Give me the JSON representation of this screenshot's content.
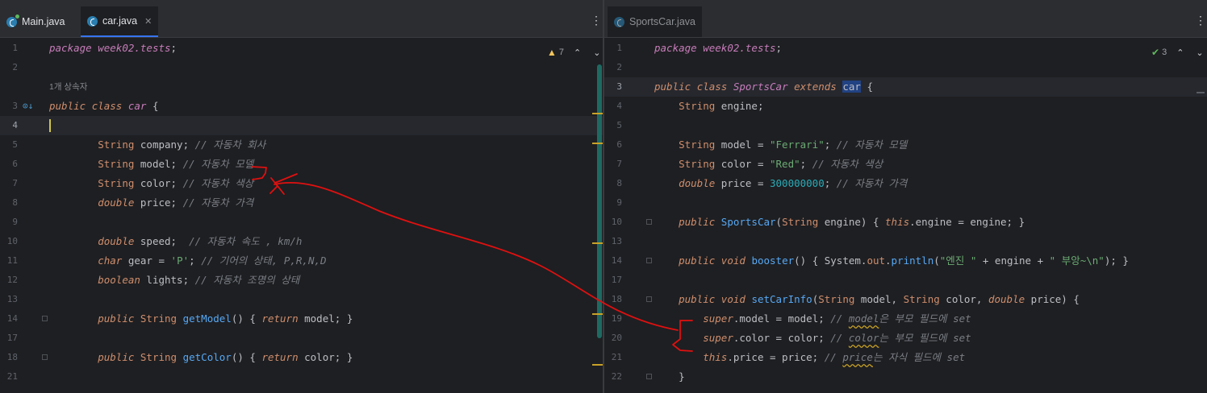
{
  "left": {
    "tabs": [
      {
        "label": "Main.java",
        "active": false
      },
      {
        "label": "car.java",
        "active": true
      }
    ],
    "inspection": {
      "count": "7"
    },
    "inheritors_hint": "1개 상속자",
    "lines": [
      {
        "n": "1",
        "tokens": [
          [
            "pkg",
            "package"
          ],
          [
            "t",
            " "
          ],
          [
            "pkg",
            "week02.tests"
          ],
          [
            "t",
            ";"
          ]
        ]
      },
      {
        "n": "2",
        "tokens": []
      },
      {
        "n": "3",
        "tokens": [
          [
            "kw",
            "public"
          ],
          [
            "t",
            " "
          ],
          [
            "kw",
            "class"
          ],
          [
            "t",
            " "
          ],
          [
            "cls",
            "car"
          ],
          [
            "t",
            " {"
          ]
        ]
      },
      {
        "n": "4",
        "tokens": []
      },
      {
        "n": "5",
        "tokens": [
          [
            "t",
            "        "
          ],
          [
            "type",
            "String"
          ],
          [
            "t",
            " company; "
          ],
          [
            "cm",
            "// 자동차 회사"
          ]
        ]
      },
      {
        "n": "6",
        "tokens": [
          [
            "t",
            "        "
          ],
          [
            "type",
            "String"
          ],
          [
            "t",
            " model; "
          ],
          [
            "cm",
            "// 자동차 모델"
          ]
        ]
      },
      {
        "n": "7",
        "tokens": [
          [
            "t",
            "        "
          ],
          [
            "type",
            "String"
          ],
          [
            "t",
            " color; "
          ],
          [
            "cm",
            "// 자동차 색상"
          ]
        ]
      },
      {
        "n": "8",
        "tokens": [
          [
            "t",
            "        "
          ],
          [
            "kw",
            "double"
          ],
          [
            "t",
            " price; "
          ],
          [
            "cm",
            "// 자동차 가격"
          ]
        ]
      },
      {
        "n": "9",
        "tokens": []
      },
      {
        "n": "10",
        "tokens": [
          [
            "t",
            "        "
          ],
          [
            "kw",
            "double"
          ],
          [
            "t",
            " speed;  "
          ],
          [
            "cm",
            "// 자동차 속도 , km/h"
          ]
        ]
      },
      {
        "n": "11",
        "tokens": [
          [
            "t",
            "        "
          ],
          [
            "kw",
            "char"
          ],
          [
            "t",
            " gear = "
          ],
          [
            "str",
            "'P'"
          ],
          [
            "t",
            "; "
          ],
          [
            "cm",
            "// 기어의 상태, P,R,N,D"
          ]
        ]
      },
      {
        "n": "12",
        "tokens": [
          [
            "t",
            "        "
          ],
          [
            "kw",
            "boolean"
          ],
          [
            "t",
            " lights; "
          ],
          [
            "cm",
            "// 자동차 조명의 상태"
          ]
        ]
      },
      {
        "n": "13",
        "tokens": []
      },
      {
        "n": "14",
        "tokens": [
          [
            "t",
            "        "
          ],
          [
            "kw",
            "public"
          ],
          [
            "t",
            " "
          ],
          [
            "type",
            "String"
          ],
          [
            "t",
            " "
          ],
          [
            "fn",
            "getModel"
          ],
          [
            "t",
            "() { "
          ],
          [
            "kw",
            "return"
          ],
          [
            "t",
            " model; }"
          ]
        ]
      },
      {
        "n": "17",
        "tokens": []
      },
      {
        "n": "18",
        "tokens": [
          [
            "t",
            "        "
          ],
          [
            "kw",
            "public"
          ],
          [
            "t",
            " "
          ],
          [
            "type",
            "String"
          ],
          [
            "t",
            " "
          ],
          [
            "fn",
            "getColor"
          ],
          [
            "t",
            "() { "
          ],
          [
            "kw",
            "return"
          ],
          [
            "t",
            " color; }"
          ]
        ]
      },
      {
        "n": "21",
        "tokens": []
      }
    ]
  },
  "right": {
    "tabs": [
      {
        "label": "SportsCar.java",
        "active": false
      }
    ],
    "inspection": {
      "count": "3"
    },
    "lines": [
      {
        "n": "1",
        "tokens": [
          [
            "pkg",
            "package"
          ],
          [
            "t",
            " "
          ],
          [
            "pkg",
            "week02.tests"
          ],
          [
            "t",
            ";"
          ]
        ]
      },
      {
        "n": "2",
        "tokens": []
      },
      {
        "n": "3",
        "tokens": [
          [
            "kw",
            "public"
          ],
          [
            "t",
            " "
          ],
          [
            "kw",
            "class"
          ],
          [
            "t",
            " "
          ],
          [
            "cls",
            "SportsCar"
          ],
          [
            "t",
            " "
          ],
          [
            "kw",
            "extends"
          ],
          [
            "t",
            " "
          ],
          [
            "hl",
            "car"
          ],
          [
            "t",
            " {"
          ]
        ]
      },
      {
        "n": "4",
        "tokens": [
          [
            "t",
            "    "
          ],
          [
            "type",
            "String"
          ],
          [
            "t",
            " engine;"
          ]
        ]
      },
      {
        "n": "5",
        "tokens": []
      },
      {
        "n": "6",
        "tokens": [
          [
            "t",
            "    "
          ],
          [
            "type",
            "String"
          ],
          [
            "t",
            " model = "
          ],
          [
            "str",
            "\"Ferrari\""
          ],
          [
            "t",
            "; "
          ],
          [
            "cm",
            "// 자동차 모델"
          ]
        ]
      },
      {
        "n": "7",
        "tokens": [
          [
            "t",
            "    "
          ],
          [
            "type",
            "String"
          ],
          [
            "t",
            " color = "
          ],
          [
            "str",
            "\"Red\""
          ],
          [
            "t",
            "; "
          ],
          [
            "cm",
            "// 자동차 색상"
          ]
        ]
      },
      {
        "n": "8",
        "tokens": [
          [
            "t",
            "    "
          ],
          [
            "kw",
            "double"
          ],
          [
            "t",
            " price = "
          ],
          [
            "num",
            "300000000"
          ],
          [
            "t",
            "; "
          ],
          [
            "cm",
            "// 자동차 가격"
          ]
        ]
      },
      {
        "n": "9",
        "tokens": []
      },
      {
        "n": "10",
        "tokens": [
          [
            "t",
            "    "
          ],
          [
            "kw",
            "public"
          ],
          [
            "t",
            " "
          ],
          [
            "fn",
            "SportsCar"
          ],
          [
            "t",
            "("
          ],
          [
            "type",
            "String"
          ],
          [
            "t",
            " engine) { "
          ],
          [
            "kw",
            "this"
          ],
          [
            "t",
            ".engine = engine; }"
          ]
        ]
      },
      {
        "n": "13",
        "tokens": []
      },
      {
        "n": "14",
        "tokens": [
          [
            "t",
            "    "
          ],
          [
            "kw",
            "public"
          ],
          [
            "t",
            " "
          ],
          [
            "kw",
            "void"
          ],
          [
            "t",
            " "
          ],
          [
            "fn",
            "booster"
          ],
          [
            "t",
            "() { System."
          ],
          [
            "kwn",
            "out"
          ],
          [
            "t",
            "."
          ],
          [
            "fn",
            "println"
          ],
          [
            "t",
            "("
          ],
          [
            "str",
            "\"엔진 \""
          ],
          [
            "t",
            " + engine + "
          ],
          [
            "str",
            "\" 부앙~\\n\""
          ],
          [
            "t",
            "); }"
          ]
        ]
      },
      {
        "n": "17",
        "tokens": []
      },
      {
        "n": "18",
        "tokens": [
          [
            "t",
            "    "
          ],
          [
            "kw",
            "public"
          ],
          [
            "t",
            " "
          ],
          [
            "kw",
            "void"
          ],
          [
            "t",
            " "
          ],
          [
            "fn",
            "setCarInfo"
          ],
          [
            "t",
            "("
          ],
          [
            "type",
            "String"
          ],
          [
            "t",
            " model, "
          ],
          [
            "type",
            "String"
          ],
          [
            "t",
            " color, "
          ],
          [
            "kw",
            "double"
          ],
          [
            "t",
            " price) {"
          ]
        ]
      },
      {
        "n": "19",
        "tokens": [
          [
            "t",
            "        "
          ],
          [
            "kw",
            "super"
          ],
          [
            "t",
            ".model = model; "
          ],
          [
            "cm",
            "// "
          ],
          [
            "cmw",
            "model"
          ],
          [
            "cm",
            "은 부모 필드에 set"
          ]
        ]
      },
      {
        "n": "20",
        "tokens": [
          [
            "t",
            "        "
          ],
          [
            "kw",
            "super"
          ],
          [
            "t",
            ".color = color; "
          ],
          [
            "cm",
            "// "
          ],
          [
            "cmw",
            "color"
          ],
          [
            "cm",
            "는 부모 필드에 set"
          ]
        ]
      },
      {
        "n": "21",
        "tokens": [
          [
            "t",
            "        "
          ],
          [
            "kw",
            "this"
          ],
          [
            "t",
            ".price = price; "
          ],
          [
            "cm",
            "// "
          ],
          [
            "cmw",
            "price"
          ],
          [
            "cm",
            "는 자식 필드에 set"
          ]
        ]
      },
      {
        "n": "22",
        "tokens": [
          [
            "t",
            "    }"
          ]
        ]
      }
    ]
  },
  "icons": {
    "tab_file": "java-class-icon",
    "warning": "warning-triangle-icon",
    "ok": "check-icon",
    "override": "override-gutter-icon",
    "menu": "kebab-menu-icon"
  },
  "colors": {
    "editor_bg": "#1e1f22",
    "keyword": "#cf8e6d",
    "comment": "#7a7e85",
    "string": "#6aab73",
    "number": "#2aacb8",
    "function": "#56a8f5",
    "annotation_red": "#e01010"
  }
}
